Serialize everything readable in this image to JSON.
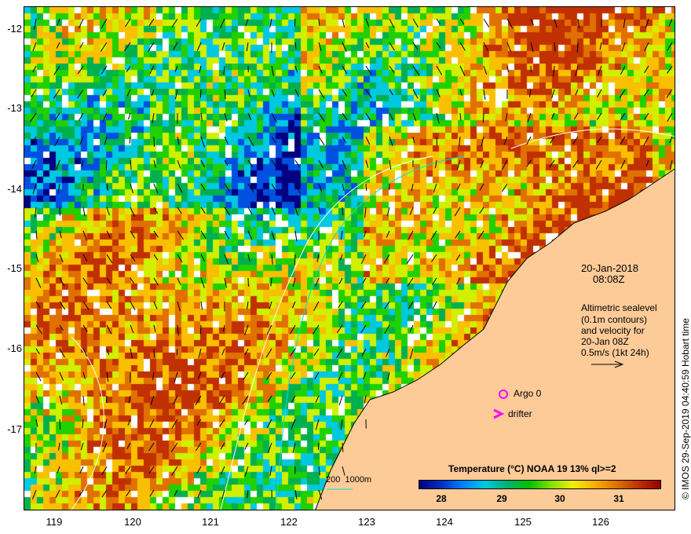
{
  "axes": {
    "x_ticks": [
      "119",
      "120",
      "121",
      "122",
      "123",
      "124",
      "125",
      "126"
    ],
    "y_ticks": [
      "-12",
      "-13",
      "-14",
      "-15",
      "-16",
      "-17"
    ]
  },
  "annotation": {
    "date": "20-Jan-2018",
    "time": "08:08Z",
    "desc": [
      "Altimetric sealevel",
      "(0.1m contours)",
      "and velocity for",
      "20-Jan 08Z",
      "0.5m/s (1kt 24h)"
    ]
  },
  "legend": {
    "argo": "Argo 0",
    "drifter": "drifter",
    "depth": "200  1000m"
  },
  "colorbar": {
    "title": "Temperature (°C) NOAA 19 13% ql>=2",
    "labels": [
      "28",
      "29",
      "30",
      "31"
    ],
    "range": [
      27.6,
      31.7
    ]
  },
  "credit": "© IMOS 29-Sep-2019 04:40:59 Hobart time",
  "colors": {
    "land": "#fdcb98",
    "argo": "#ff00ff",
    "contour": "#ffffff",
    "isobath": "#00e0e0"
  }
}
